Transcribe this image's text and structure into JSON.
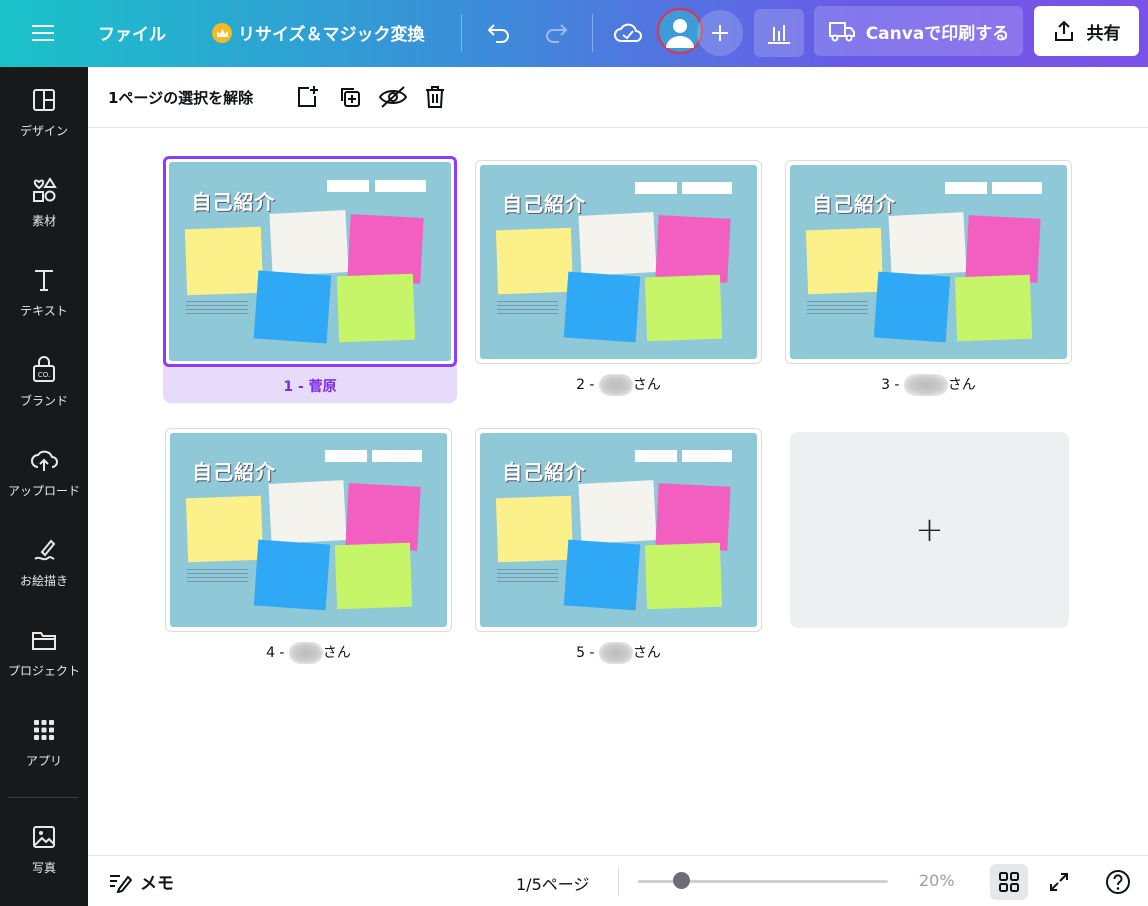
{
  "topbar": {
    "file_label": "ファイル",
    "resize_label": "リサイズ＆マジック変換",
    "print_label": "Canvaで印刷する",
    "share_label": "共有",
    "gradient_start": "#19c3c9",
    "gradient_end": "#7b52e9"
  },
  "sidebar": {
    "items": [
      {
        "label": "デザイン",
        "icon": "layout-icon"
      },
      {
        "label": "素材",
        "icon": "elements-icon"
      },
      {
        "label": "テキスト",
        "icon": "text-icon"
      },
      {
        "label": "ブランド",
        "icon": "brand-icon"
      },
      {
        "label": "アップロード",
        "icon": "upload-icon"
      },
      {
        "label": "お絵描き",
        "icon": "draw-icon"
      },
      {
        "label": "プロジェクト",
        "icon": "folder-icon"
      },
      {
        "label": "アプリ",
        "icon": "apps-icon"
      },
      {
        "label": "写真",
        "icon": "photo-icon"
      }
    ]
  },
  "toolbar": {
    "deselect_label": "1ページの選択を解除"
  },
  "pages": [
    {
      "number_label": "1 - 菅原",
      "selected": true
    },
    {
      "number_label": "2 - ",
      "suffix": "さん",
      "selected": false
    },
    {
      "number_label": "3 - ",
      "suffix": "さん",
      "selected": false
    },
    {
      "number_label": "4 - ",
      "suffix": "さん",
      "selected": false
    },
    {
      "number_label": "5 - ",
      "suffix": "さん",
      "selected": false
    }
  ],
  "slide": {
    "title": "自己紹介",
    "background": "#8fc8d6",
    "note_colors": [
      "#fbf08a",
      "#f5f3ee",
      "#f25fc0",
      "#2fa8f5",
      "#c7f56a"
    ]
  },
  "add_page_symbol": "+",
  "bottombar": {
    "memo_label": "メモ",
    "page_count": "1/5ページ",
    "zoom_label": "20%"
  }
}
